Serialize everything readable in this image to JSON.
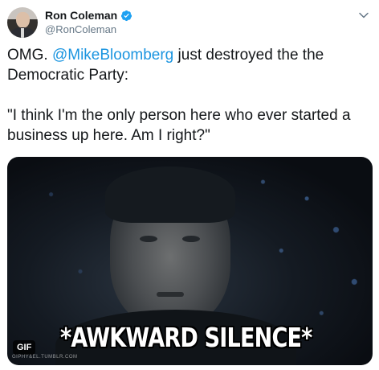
{
  "author": {
    "display_name": "Ron Coleman",
    "handle": "@RonColeman",
    "verified": true,
    "verified_color": "#1da1f2"
  },
  "tweet": {
    "line1_prefix": "OMG. ",
    "mention": "@MikeBloomberg",
    "line1_suffix": " just destroyed the the Democratic Party:",
    "quote": "\"I think I'm the only person here who ever started a business up here. Am I right?\"",
    "mention_color": "#1b95e0"
  },
  "media": {
    "caption": "*AWKWARD SILENCE*",
    "badge": "GIF",
    "watermark": "GIPHY&EL.TUMBLR.COM"
  },
  "icons": {
    "more": "chevron-down-icon",
    "verified": "verified-badge-icon"
  }
}
